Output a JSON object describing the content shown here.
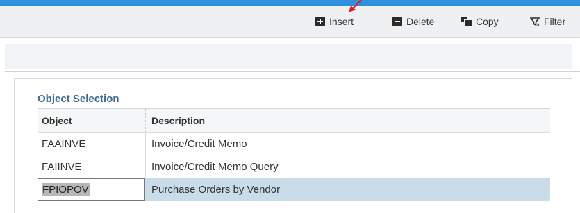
{
  "toolbar": {
    "insert_label": "Insert",
    "delete_label": "Delete",
    "copy_label": "Copy",
    "filter_label": "Filter",
    "icons": [
      "plus-square-icon",
      "minus-square-icon",
      "copy-icon",
      "filter-icon"
    ]
  },
  "annotation": {
    "arrow_color": "#e01c1c"
  },
  "section": {
    "title": "Object Selection"
  },
  "grid": {
    "columns": [
      "Object",
      "Description"
    ],
    "rows": [
      {
        "object": "FAAINVE",
        "description": "Invoice/Credit Memo"
      },
      {
        "object": "FAIINVE",
        "description": "Invoice/Credit Memo Query"
      },
      {
        "object": "FPIOPOV",
        "description": "Purchase Orders by Vendor",
        "selected": true
      }
    ]
  },
  "colors": {
    "accent": "#2f8fdb",
    "section_title": "#3c6b98",
    "selected_row": "#c8dcea"
  }
}
